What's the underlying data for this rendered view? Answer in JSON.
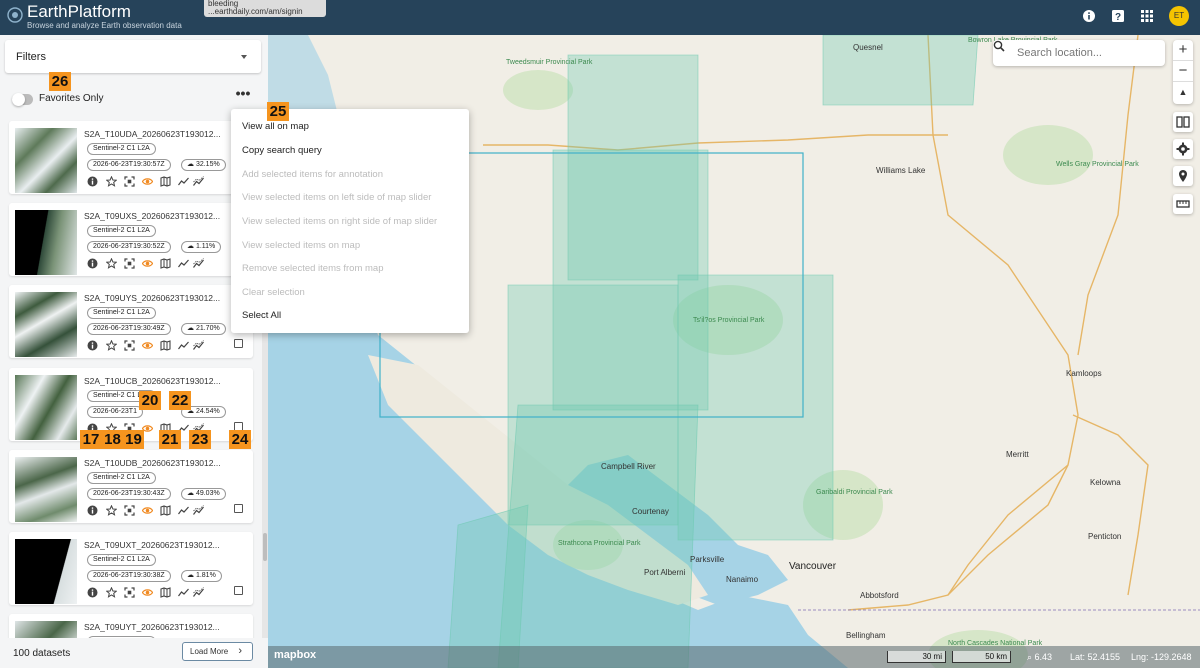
{
  "header": {
    "title": "EarthPlatform",
    "subtitle": "Browse and analyze Earth observation data",
    "tooltip_line1": "bleeding",
    "tooltip_line2": "...earthdaily.com/am/signin",
    "avatar_initials": "ET",
    "icons": [
      "info-icon",
      "help-icon",
      "apps-grid-icon"
    ]
  },
  "sidebar": {
    "filters_label": "Filters",
    "favorites_label": "Favorites Only",
    "favorites_on": false,
    "more_label": "•••",
    "items": [
      {
        "title": "S2A_T10UDA_20260623T193012...",
        "collection": "Sentinel-2 C1 L2A",
        "datetime": "2026-06-23T19:30:57Z",
        "cloud": "32.15%",
        "checkbox": false
      },
      {
        "title": "S2A_T09UXS_20260623T193012...",
        "collection": "Sentinel-2 C1 L2A",
        "datetime": "2026-06-23T19:30:52Z",
        "cloud": "1.11%",
        "checkbox": false
      },
      {
        "title": "S2A_T09UYS_20260623T193012...",
        "collection": "Sentinel-2 C1 L2A",
        "datetime": "2026-06-23T19:30:49Z",
        "cloud": "21.70%",
        "checkbox": true
      },
      {
        "title": "S2A_T10UCB_20260623T193012...",
        "collection": "Sentinel-2 C1 L2A",
        "datetime": "2026-06-23T1",
        "datetime_tail": "?2",
        "cloud": "24.54%",
        "checkbox": true
      },
      {
        "title": "S2A_T10UDB_20260623T193012...",
        "collection": "Sentinel-2 C1 L2A",
        "datetime": "2026-06-23T19:30:43Z",
        "cloud": "49.03%",
        "checkbox": true
      },
      {
        "title": "S2A_T09UXT_20260623T193012...",
        "collection": "Sentinel-2 C1 L2A",
        "datetime": "2026-06-23T19:30:38Z",
        "cloud": "1.81%",
        "checkbox": true
      },
      {
        "title": "S2A_T09UYT_20260623T193012...",
        "collection": "Sentinel-2 C1 L2A",
        "datetime": "",
        "cloud": "",
        "checkbox": false
      }
    ],
    "dataset_count": "100 datasets",
    "load_more": "Load More",
    "load_more_chevron": "›"
  },
  "menu": {
    "items": [
      {
        "label": "View all on map",
        "enabled": true
      },
      {
        "label": "Copy search query",
        "enabled": true
      },
      {
        "label": "Add selected items for annotation",
        "enabled": false
      },
      {
        "label": "View selected items on left side of map slider",
        "enabled": false
      },
      {
        "label": "View selected items on right side of map slider",
        "enabled": false
      },
      {
        "label": "View selected items on map",
        "enabled": false
      },
      {
        "label": "Remove selected items from map",
        "enabled": false
      },
      {
        "label": "Clear selection",
        "enabled": false
      },
      {
        "label": "Select All",
        "enabled": true
      }
    ]
  },
  "map": {
    "search_placeholder": "Search location...",
    "zoom_in": "+",
    "zoom_out": "−",
    "compass": "▲",
    "attribution": "mapbox",
    "scale_1": "30 mi",
    "scale_2": "50 km",
    "zoom_level": "6.43",
    "lat": "Lat:  52.4155",
    "lng": "Lng: -129.2648",
    "labels": {
      "tweedsmuir": "Tweedsmuir Provincial Park",
      "quesnel": "Quesnel",
      "bowron": "Bowron Lake Provincial Park",
      "wells_gray": "Wells Gray Provincial Park",
      "williams_lake": "Williams Lake",
      "tatlatui": "Ts'il?os Provincial Park",
      "kamloops": "Kamloops",
      "merritt": "Merritt",
      "kelowna": "Kelowna",
      "penticton": "Penticton",
      "campbell_river": "Campbell River",
      "courtenay": "Courtenay",
      "strathcona": "Strathcona Provincial Park",
      "garibaldi": "Garibaldi Provincial Park",
      "parksville": "Parksville",
      "nanaimo": "Nanaimo",
      "port_alberni": "Port Alberni",
      "vancouver": "Vancouver",
      "abbotsford": "Abbotsford",
      "bellingham": "Bellingham",
      "north_cascades": "North Cascades National Park",
      "hwy_20": "20",
      "hwy_97": "97",
      "hwy_5": "5",
      "hwy_1": "1",
      "hwy_19a": "19A",
      "hwy_28": "28",
      "hwy_30": "30"
    },
    "colors": {
      "footprint_fill": "#6dc9b0",
      "footprint_stroke": "#3fb1c9",
      "water": "#a6d3e6",
      "land": "#f1eee6"
    }
  },
  "badges": {
    "b17": "17",
    "b18": "18",
    "b19": "19",
    "b20": "20",
    "b21": "21",
    "b22": "22",
    "b23": "23",
    "b24": "24",
    "b25": "25",
    "b26": "26"
  }
}
